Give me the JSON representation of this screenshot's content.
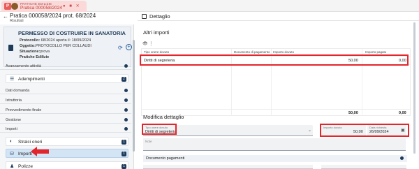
{
  "tab": {
    "small_label": "PRATICHE EDILIZIE",
    "title": "Pratica 000058/2024",
    "icon_letter": "P",
    "controls": "● ■ ✕"
  },
  "left": {
    "back_icon": "←",
    "title": "Pratica 000058/2024 prot. 68/2024",
    "subtitle": "Risultati",
    "card": {
      "title": "PERMESSO DI COSTRUIRE IN SANATORIA",
      "protocollo_label": "Protocollo:",
      "protocollo_value": "68/2024 aperta il: 18/09/2024",
      "oggetto_label": "Oggetto:",
      "oggetto_value": "PROTOCOLLO PER COLLAUDI",
      "situazione_label": "Situazione:",
      "situazione_value": "prova",
      "categoria": "Pratiche Edilizie"
    },
    "sections": {
      "avanzamento": "Avanzamento attività",
      "adempimenti": "Adempimenti",
      "adempimenti_count": "2",
      "dati_domanda": "Dati domanda",
      "istruttoria": "Istruttoria",
      "provvedimento": "Provvedimento finale",
      "gestione": "Gestione",
      "importi": "Importi"
    },
    "subitems": {
      "stralci": "Stralci oneri",
      "stralci_count": "1",
      "importi": "Importi",
      "importi_count": "1",
      "polizze": "Polizze",
      "polizze_count": "1"
    }
  },
  "right": {
    "header": "Dettaglio",
    "altri_importi": "Altri importi",
    "toolbar_icons": "👁  ⋮",
    "table": {
      "headers": [
        "Tipo onere dovuto",
        "Documento di pagamento",
        "Importo dovuto",
        "Importo pagato"
      ],
      "rows": [
        [
          "Diritti di segreteria",
          "",
          "50,00",
          "0,00"
        ]
      ],
      "footer_dovuto": "50,00",
      "footer_pagato": "0,00"
    },
    "modifica_title": "Modifica dettaglio",
    "form": {
      "tipo_label": "Tipo onere dovuto",
      "tipo_value": "Diritti di segreteria",
      "importo_label": "Importo dovuto",
      "importo_value": "50,00",
      "data_label": "Data richiesta",
      "data_value": "26/09/2024",
      "note_label": "Note",
      "documento_pagamenti": "Documento pagamenti"
    }
  },
  "colors": {
    "accent": "#1f3b5a",
    "highlight": "#e3262c",
    "active_item": "#d3e4f5"
  }
}
